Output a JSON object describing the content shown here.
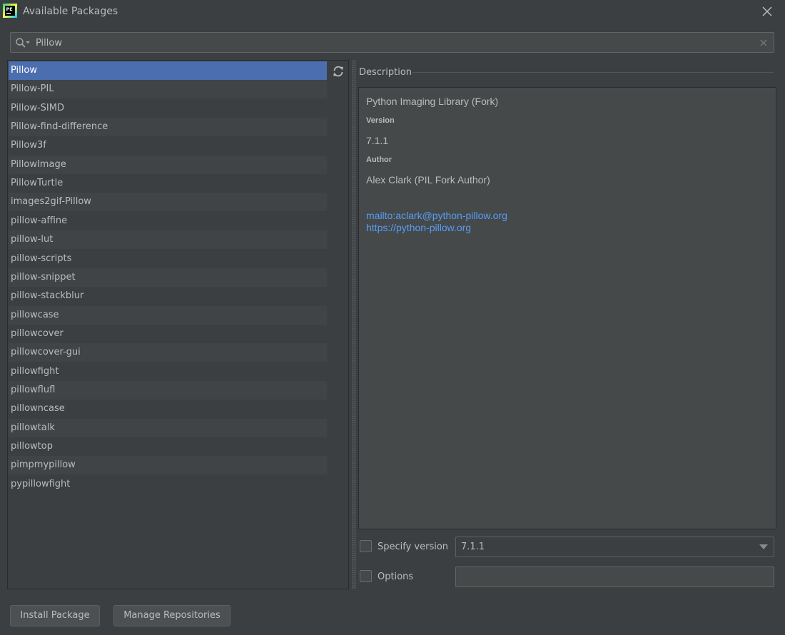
{
  "window": {
    "title": "Available Packages",
    "logo_text": "PE"
  },
  "search": {
    "value": "Pillow",
    "placeholder": ""
  },
  "packages": [
    "Pillow",
    "Pillow-PIL",
    "Pillow-SIMD",
    "Pillow-find-difference",
    "Pillow3f",
    "PillowImage",
    "PillowTurtle",
    "images2gif-Pillow",
    "pillow-affine",
    "pillow-lut",
    "pillow-scripts",
    "pillow-snippet",
    "pillow-stackblur",
    "pillowcase",
    "pillowcover",
    "pillowcover-gui",
    "pillowfight",
    "pillowflufl",
    "pillowncase",
    "pillowtalk",
    "pillowtop",
    "pimpmypillow",
    "pypillowfight"
  ],
  "selected_package": "Pillow",
  "description": {
    "legend": "Description",
    "summary": "Python Imaging Library (Fork)",
    "version_label": "Version",
    "version": "7.1.1",
    "author_label": "Author",
    "author": "Alex Clark (PIL Fork Author)",
    "links": [
      "mailto:aclark@python-pillow.org",
      "https://python-pillow.org"
    ]
  },
  "options": {
    "specify_version_label": "Specify version",
    "specify_version_checked": false,
    "version_value": "7.1.1",
    "options_label": "Options",
    "options_checked": false,
    "options_value": ""
  },
  "buttons": {
    "install": "Install Package",
    "manage": "Manage Repositories"
  },
  "colors": {
    "background": "#3c3f41",
    "selection": "#4b6eaf",
    "link": "#589df6"
  }
}
